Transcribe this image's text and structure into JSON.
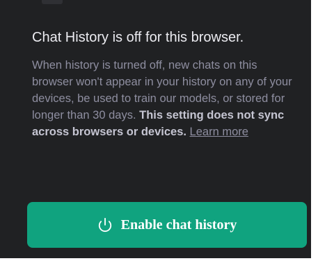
{
  "dialog": {
    "title": "Chat History is off for this browser.",
    "description_plain": "When history is turned off, new chats on this browser won't appear in your history on any of your devices, be used to train our models, or stored for longer than 30 days.",
    "description_bold": "This setting does not sync across browsers or devices.",
    "learn_more_label": "Learn more",
    "button": {
      "label": "Enable chat history",
      "icon": "power-icon",
      "color": "#10a37f"
    },
    "background_color": "#202123"
  }
}
